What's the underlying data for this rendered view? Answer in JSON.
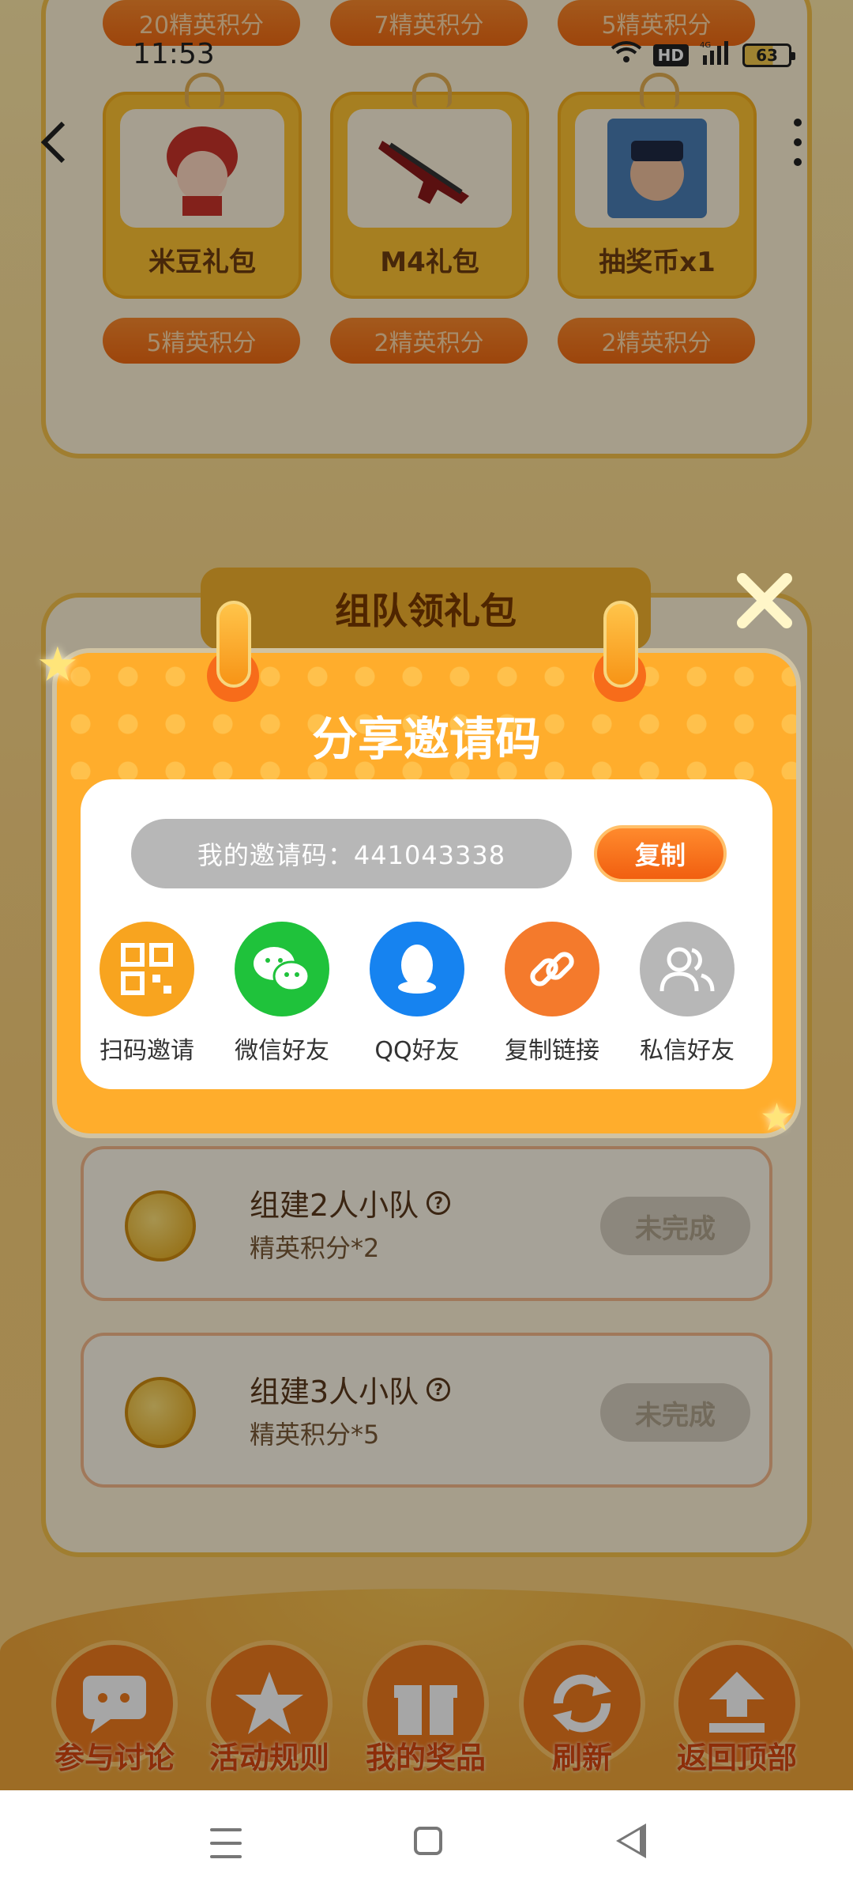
{
  "status_bar": {
    "time": "11:53",
    "hd": "HD",
    "net": "4G",
    "battery": "63"
  },
  "prizes": {
    "top_points": [
      "20精英积分",
      "7精英积分",
      "5精英积分"
    ],
    "items": [
      {
        "label": "米豆礼包",
        "points": "5精英积分"
      },
      {
        "label": "M4礼包",
        "points": "2精英积分"
      },
      {
        "label": "抽奖币x1",
        "points": "2精英积分"
      }
    ]
  },
  "team": {
    "title": "组队领礼包",
    "tasks": [
      {
        "title": "组建2人小队",
        "reward": "精英积分*2",
        "status": "未完成"
      },
      {
        "title": "组建3人小队",
        "reward": "精英积分*5",
        "status": "未完成"
      }
    ]
  },
  "bottom_nav": [
    "参与讨论",
    "活动规则",
    "我的奖品",
    "刷新",
    "返回顶部"
  ],
  "modal": {
    "title": "分享邀请码",
    "invite_code_text": "我的邀请码：441043338",
    "copy_label": "复制",
    "share_options": [
      {
        "label": "扫码邀请",
        "icon": "qr-code-icon",
        "color": "#f8a41f"
      },
      {
        "label": "微信好友",
        "icon": "wechat-icon",
        "color": "#1fc23b"
      },
      {
        "label": "QQ好友",
        "icon": "qq-icon",
        "color": "#1683f0"
      },
      {
        "label": "复制链接",
        "icon": "link-icon",
        "color": "#f47a2c"
      },
      {
        "label": "私信好友",
        "icon": "users-icon",
        "color": "#b7b7b7"
      }
    ]
  },
  "colors": {
    "accent": "#ffad2c",
    "copy_button": "#f15f10"
  }
}
